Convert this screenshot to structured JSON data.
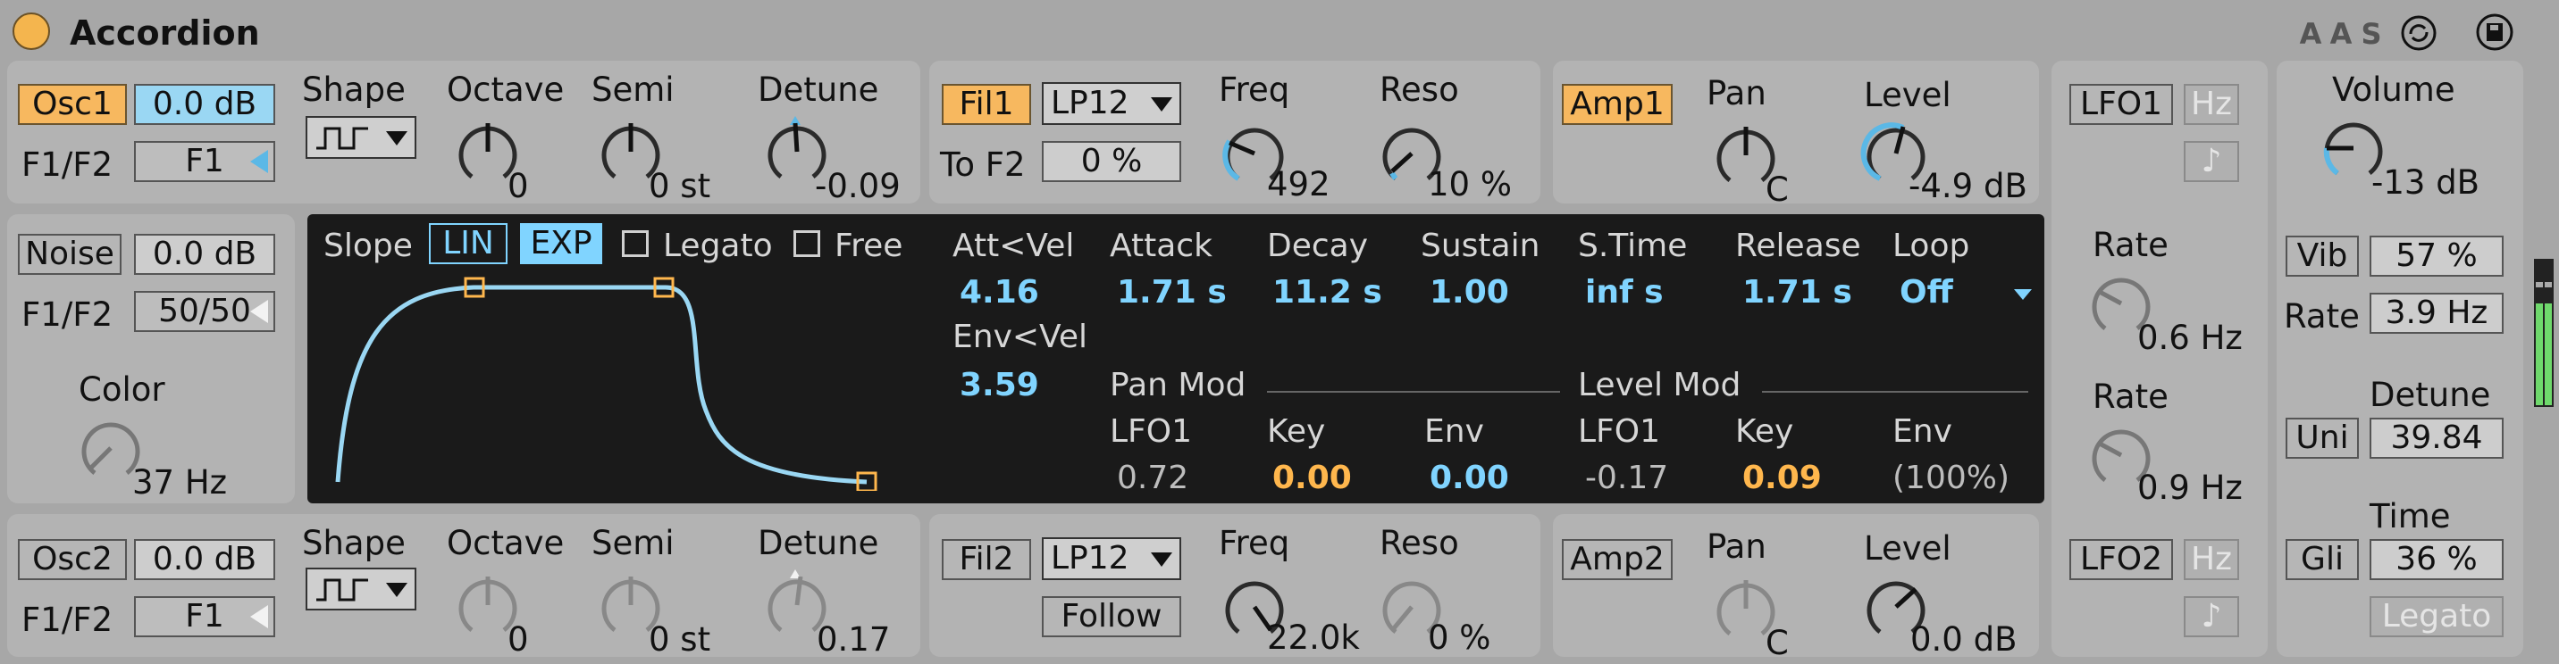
{
  "title": "Accordion",
  "header_buttons": [
    "A",
    "A",
    "S"
  ],
  "osc1": {
    "label": "Osc1",
    "level": "0.0 dB",
    "f1f2_label": "F1/F2",
    "route": "F1",
    "shape_label": "Shape",
    "octave_label": "Octave",
    "octave": "0",
    "semi_label": "Semi",
    "semi": "0 st",
    "detune_label": "Detune",
    "detune": "-0.09"
  },
  "fil1": {
    "label": "Fil1",
    "type": "LP12",
    "to_label": "To F2",
    "to_value": "0 %",
    "freq_label": "Freq",
    "freq": "492",
    "reso_label": "Reso",
    "reso": "10 %"
  },
  "amp1": {
    "label": "Amp1",
    "pan_label": "Pan",
    "pan": "C",
    "level_label": "Level",
    "level": "-4.9 dB"
  },
  "lfo1": {
    "label": "LFO1",
    "hz": "Hz",
    "note_icon": "♪",
    "rate_label": "Rate",
    "rate": "0.6 Hz"
  },
  "lfo2": {
    "label": "LFO2",
    "hz": "Hz",
    "note_icon": "♪",
    "rate_label": "Rate",
    "rate": "0.9 Hz"
  },
  "global": {
    "volume_label": "Volume",
    "volume": "-13 dB",
    "vib_label": "Vib",
    "vib": "57 %",
    "rate_label": "Rate",
    "rate": "3.9 Hz",
    "detune_label": "Detune",
    "uni_label": "Uni",
    "detune": "39.84",
    "time_label": "Time",
    "gli_label": "Gli",
    "time": "36 %",
    "legato": "Legato"
  },
  "noise": {
    "label": "Noise",
    "level": "0.0 dB",
    "f1f2_label": "F1/F2",
    "route": "50/50",
    "color_label": "Color",
    "color": "37 Hz"
  },
  "envelope": {
    "slope_label": "Slope",
    "lin": "LIN",
    "exp": "EXP",
    "legato": "Legato",
    "free": "Free",
    "att_vel_label": "Att<Vel",
    "att_vel": "4.16",
    "env_vel_label": "Env<Vel",
    "env_vel": "3.59",
    "attack_label": "Attack",
    "attack": "1.71 s",
    "decay_label": "Decay",
    "decay": "11.2 s",
    "sustain_label": "Sustain",
    "sustain": "1.00",
    "stime_label": "S.Time",
    "stime": "inf s",
    "release_label": "Release",
    "release": "1.71 s",
    "loop_label": "Loop",
    "loop": "Off",
    "pan_mod_label": "Pan Mod",
    "level_mod_label": "Level Mod",
    "lfo1_label": "LFO1",
    "key_label": "Key",
    "env_label": "Env",
    "pan_lfo1": "0.72",
    "pan_key": "0.00",
    "pan_env": "0.00",
    "level_lfo1": "-0.17",
    "level_key": "0.09",
    "level_env": "(100%)"
  },
  "osc2": {
    "label": "Osc2",
    "level": "0.0 dB",
    "f1f2_label": "F1/F2",
    "route": "F1",
    "shape_label": "Shape",
    "octave_label": "Octave",
    "octave": "0",
    "semi_label": "Semi",
    "semi": "0 st",
    "detune_label": "Detune",
    "detune": "0.17"
  },
  "fil2": {
    "label": "Fil2",
    "type": "LP12",
    "follow": "Follow",
    "freq_label": "Freq",
    "freq": "22.0k",
    "reso_label": "Reso",
    "reso": "0 %"
  },
  "amp2": {
    "label": "Amp2",
    "pan_label": "Pan",
    "pan": "C",
    "level_label": "Level",
    "level": "0.0 dB"
  },
  "colors": {
    "device_bg": "#a7a7a7",
    "panel_bg": "#b3b3b3",
    "toggle_on": "#f7b85f",
    "value_blue": "#80d4ff",
    "value_orange": "#ffb74d",
    "screen_bg": "#1a1a1a"
  }
}
